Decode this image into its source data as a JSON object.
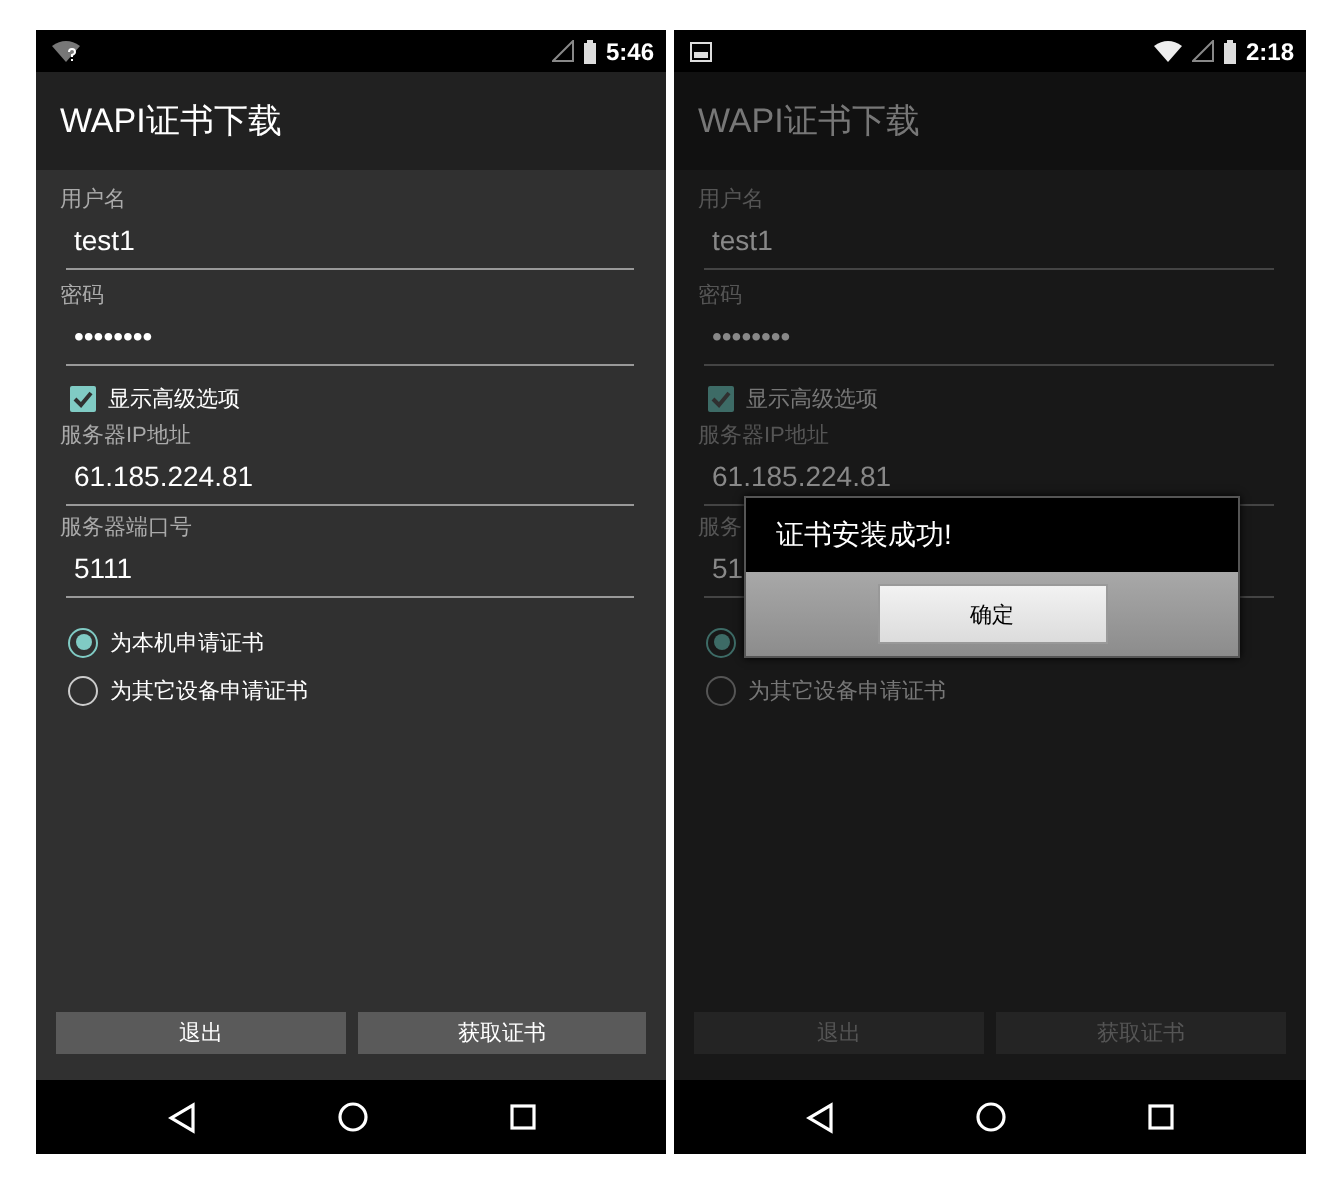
{
  "screens": [
    {
      "dimmed": false,
      "status_bar": {
        "notification_icons": [
          {
            "kind": "wifi-unknown"
          }
        ],
        "system_icons": [
          {
            "kind": "signal"
          },
          {
            "kind": "battery"
          }
        ],
        "time": "5:46"
      },
      "title": "WAPI证书下载",
      "fields": [
        {
          "label": "用户名",
          "value": "test1"
        },
        {
          "label": "密码",
          "value": "••••••••"
        }
      ],
      "advanced_option": {
        "label": "显示高级选项",
        "checked": true
      },
      "server_fields": [
        {
          "label": "服务器IP地址",
          "value": "61.185.224.81"
        },
        {
          "label": "服务器端口号",
          "value": "5111"
        }
      ],
      "radios": [
        {
          "label": "为本机申请证书",
          "selected": true
        },
        {
          "label": "为其它设备申请证书",
          "selected": false
        }
      ],
      "buttons": [
        {
          "label": "退出"
        },
        {
          "label": "获取证书"
        }
      ]
    },
    {
      "dimmed": true,
      "status_bar": {
        "notification_icons": [
          {
            "kind": "image"
          }
        ],
        "system_icons": [
          {
            "kind": "wifi"
          },
          {
            "kind": "signal"
          },
          {
            "kind": "battery"
          }
        ],
        "time": "2:18"
      },
      "title": "WAPI证书下载",
      "fields": [
        {
          "label": "用户名",
          "value": "test1"
        },
        {
          "label": "密码",
          "value": "••••••••"
        }
      ],
      "advanced_option": {
        "label": "显示高级选项",
        "checked": true
      },
      "server_fields": [
        {
          "label": "服务器IP地址",
          "value": "61.185.224.81"
        },
        {
          "label": "服务",
          "value": "51"
        }
      ],
      "radios": [
        {
          "selected": true
        },
        {
          "label": "为其它设备申请证书",
          "selected": false
        }
      ],
      "buttons": [
        {
          "label": "退出"
        },
        {
          "label": "获取证书"
        }
      ],
      "dialog": {
        "message": "证书安装成功!",
        "button": "确定"
      }
    }
  ]
}
